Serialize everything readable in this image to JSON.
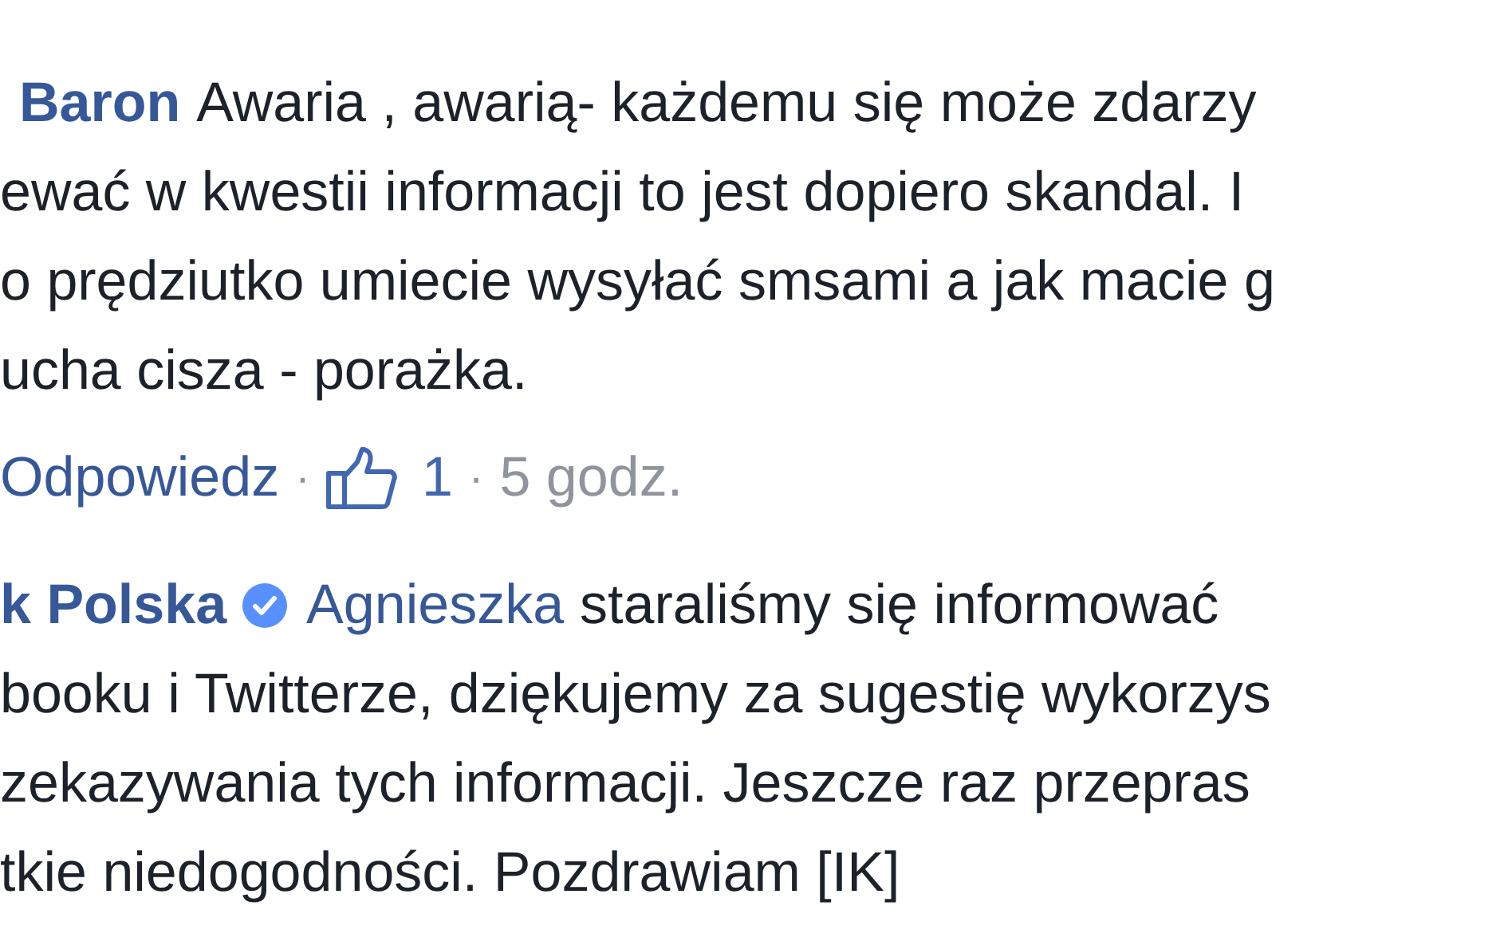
{
  "comments": [
    {
      "author": "Baron",
      "verified": false,
      "lines": [
        "Awaria , awarią- każdemu się może zdarzy",
        "ewać w kwestii informacji to jest dopiero skandal. I",
        "o prędziutko umiecie wysyłać smsami a jak macie g",
        "ucha cisza - porażka."
      ],
      "actions": [
        {
          "kind": "link",
          "text": "Odpowiedz"
        },
        {
          "kind": "sep",
          "text": "·"
        },
        {
          "kind": "like",
          "text": "1"
        },
        {
          "kind": "sep",
          "text": "·"
        },
        {
          "kind": "time",
          "text": "5 godz."
        }
      ]
    },
    {
      "author": "k Polska",
      "verified": true,
      "mention": "Agnieszka",
      "lines": [
        "staraliśmy się informować",
        "booku i Twitterze, dziękujemy za sugestię wykorzys",
        "zekazywania tych informacji. Jeszcze raz przepras",
        "tkie niedogodności. Pozdrawiam [IK]"
      ]
    }
  ]
}
